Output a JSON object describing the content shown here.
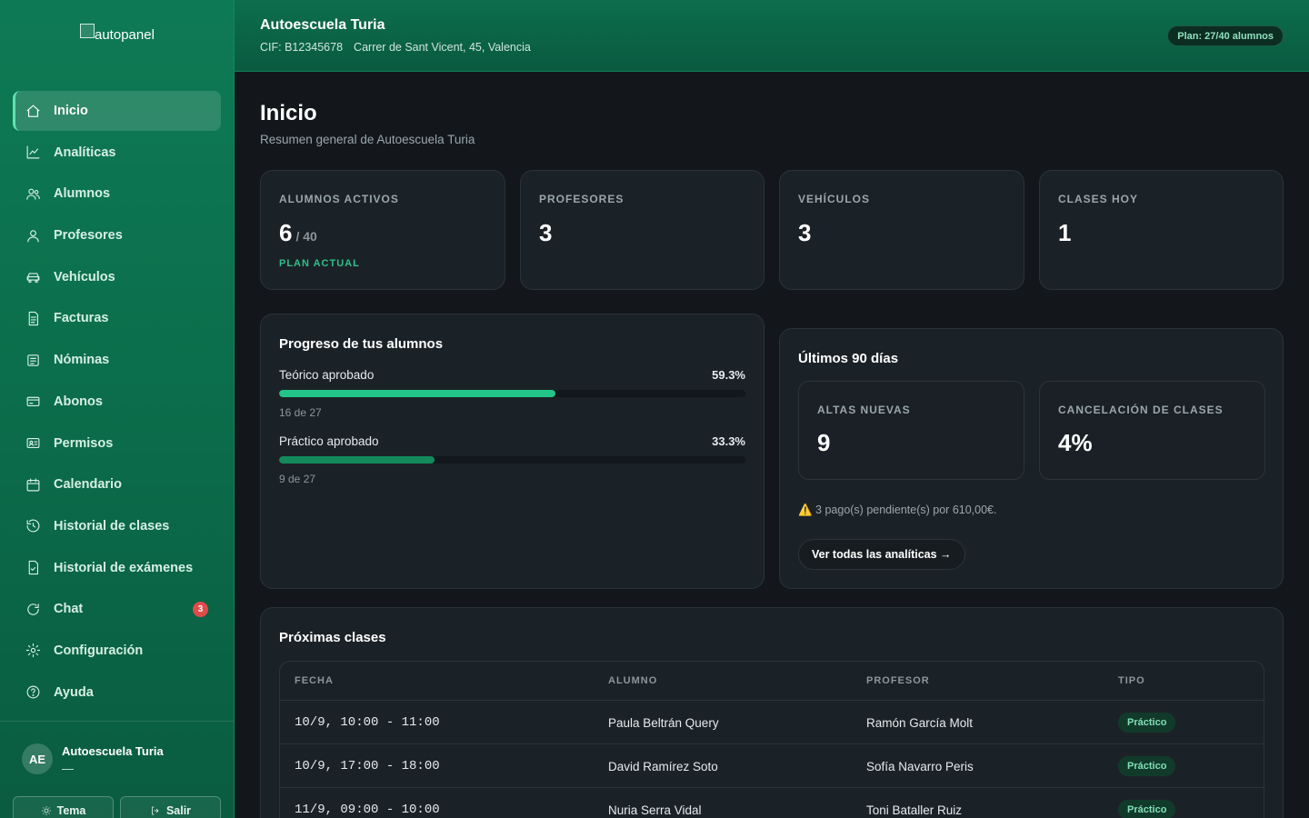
{
  "brand": {
    "logo_alt": "autopanel"
  },
  "sidebar": {
    "items": [
      {
        "label": "Inicio",
        "icon": "home-icon",
        "active": true
      },
      {
        "label": "Analíticas",
        "icon": "chart-line-icon"
      },
      {
        "label": "Alumnos",
        "icon": "users-icon"
      },
      {
        "label": "Profesores",
        "icon": "user-icon"
      },
      {
        "label": "Vehículos",
        "icon": "car-icon"
      },
      {
        "label": "Facturas",
        "icon": "file-text-icon"
      },
      {
        "label": "Nóminas",
        "icon": "receipt-icon"
      },
      {
        "label": "Abonos",
        "icon": "credit-card-icon"
      },
      {
        "label": "Permisos",
        "icon": "id-card-icon"
      },
      {
        "label": "Calendario",
        "icon": "calendar-icon"
      },
      {
        "label": "Historial de clases",
        "icon": "history-icon"
      },
      {
        "label": "Historial de exámenes",
        "icon": "file-check-icon"
      },
      {
        "label": "Chat",
        "icon": "chat-icon",
        "badge": "3"
      },
      {
        "label": "Configuración",
        "icon": "gear-icon"
      },
      {
        "label": "Ayuda",
        "icon": "help-circle-icon"
      }
    ],
    "user": {
      "initials": "AE",
      "name": "Autoescuela Turia",
      "sub": "—"
    },
    "buttons": {
      "theme": "Tema",
      "logout": "Salir"
    }
  },
  "header": {
    "org_name": "Autoescuela Turia",
    "cif": "CIF: B12345678",
    "address": "Carrer de Sant Vicent, 45, Valencia",
    "plan": "Plan: 27/40 alumnos"
  },
  "page": {
    "title": "Inicio",
    "subtitle": "Resumen general de Autoescuela Turia"
  },
  "stats": [
    {
      "label": "ALUMNOS ACTIVOS",
      "value": "6",
      "suffix": "/ 40",
      "foot": "PLAN ACTUAL"
    },
    {
      "label": "PROFESORES",
      "value": "3"
    },
    {
      "label": "VEHÍCULOS",
      "value": "3"
    },
    {
      "label": "CLASES HOY",
      "value": "1"
    }
  ],
  "progress": {
    "title": "Progreso de tus alumnos",
    "rows": [
      {
        "label": "Teórico aprobado",
        "percent_text": "59.3%",
        "fraction": 0.593,
        "sub": "16 de 27",
        "color": "#22c488"
      },
      {
        "label": "Práctico aprobado",
        "percent_text": "33.3%",
        "fraction": 0.333,
        "sub": "9 de 27",
        "color": "#138a5c"
      }
    ]
  },
  "last90": {
    "title": "Últimos 90 días",
    "metrics": [
      {
        "label": "ALTAS NUEVAS",
        "value": "9"
      },
      {
        "label": "CANCELACIÓN DE CLASES",
        "value": "4%"
      }
    ],
    "warning": "⚠️ 3 pago(s) pendiente(s) por 610,00€.",
    "link": "Ver todas las analíticas →"
  },
  "upcoming": {
    "title": "Próximas clases",
    "headers": [
      "FECHA",
      "ALUMNO",
      "PROFESOR",
      "TIPO"
    ],
    "rows": [
      {
        "fecha": "10/9, 10:00 - 11:00",
        "alumno": "Paula Beltrán Query",
        "profesor": "Ramón García Molt",
        "tipo": "Práctico"
      },
      {
        "fecha": "10/9, 17:00 - 18:00",
        "alumno": "David Ramírez Soto",
        "profesor": "Sofía Navarro Peris",
        "tipo": "Práctico"
      },
      {
        "fecha": "11/9, 09:00 - 10:00",
        "alumno": "Nuria Serra Vidal",
        "profesor": "Toni Bataller Ruiz",
        "tipo": "Práctico"
      }
    ]
  }
}
